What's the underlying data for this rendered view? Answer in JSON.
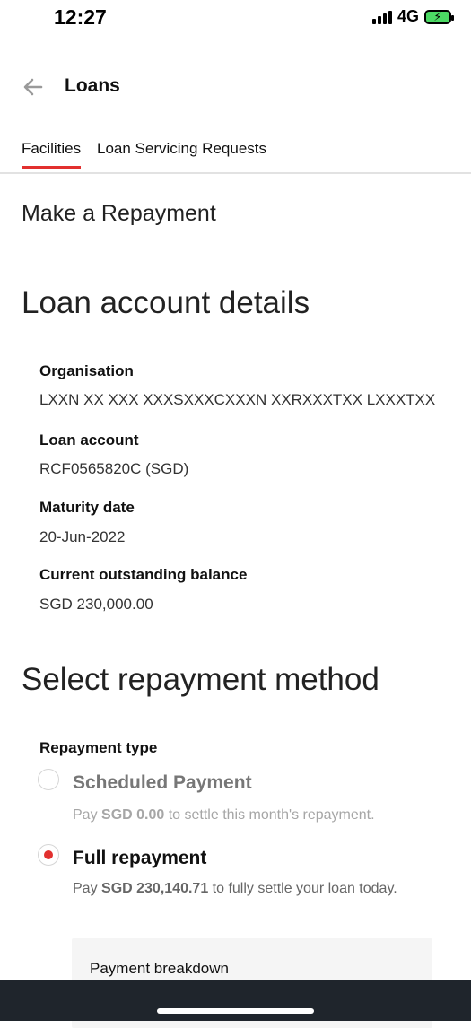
{
  "status_bar": {
    "time": "12:27",
    "network": "4G",
    "icons": [
      "signal-bars-icon",
      "battery-charging-icon"
    ]
  },
  "header": {
    "title": "Loans",
    "back_icon": "arrow-left-icon"
  },
  "tabs": [
    {
      "label": "Facilities",
      "active": true
    },
    {
      "label": "Loan Servicing Requests",
      "active": false
    }
  ],
  "page": {
    "subtitle": "Make a Repayment"
  },
  "loan_details": {
    "title": "Loan account details",
    "fields": [
      {
        "label": "Organisation",
        "value": "LXXN XX XXX XXXSXXXCXXXN XXRXXXTXX LXXXTXX"
      },
      {
        "label": "Loan account",
        "value": "RCF0565820C (SGD)"
      },
      {
        "label": "Maturity date",
        "value": "20-Jun-2022"
      },
      {
        "label": "Current outstanding balance",
        "value": "SGD 230,000.00"
      }
    ]
  },
  "repayment": {
    "title": "Select repayment method",
    "type_label": "Repayment type",
    "options": [
      {
        "title": "Scheduled Payment",
        "selected": false,
        "desc_prefix": "Pay ",
        "desc_amount": "SGD 0.00",
        "desc_suffix": " to settle this month's repayment."
      },
      {
        "title": "Full repayment",
        "selected": true,
        "desc_prefix": "Pay ",
        "desc_amount": "SGD 230,140.71",
        "desc_suffix": " to fully settle your loan today."
      }
    ],
    "breakdown_label": "Payment breakdown"
  },
  "colors": {
    "accent": "#e2302f",
    "bottom_bar": "#1f252c"
  }
}
